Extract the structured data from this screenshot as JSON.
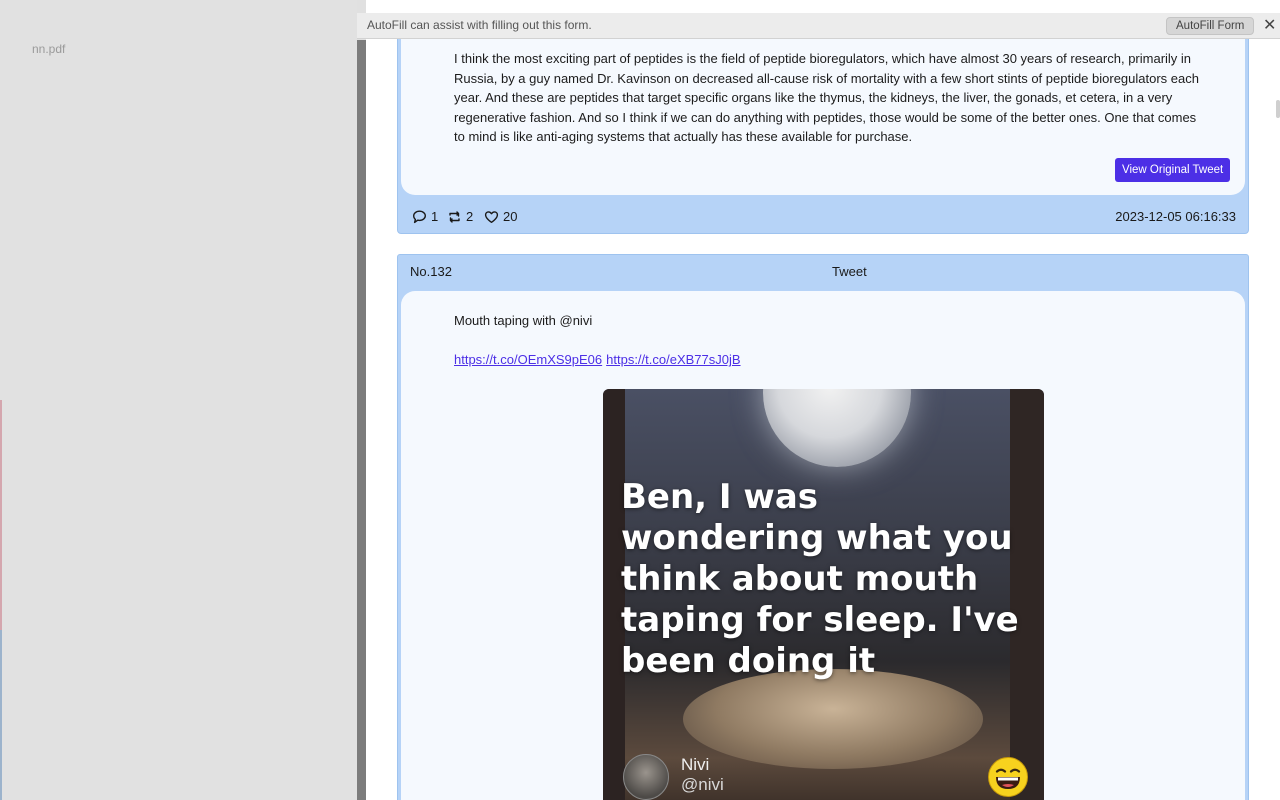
{
  "sidebar": {
    "file_name": "nn.pdf"
  },
  "autofill": {
    "message": "AutoFill can assist with filling out this form.",
    "button_label": "AutoFill Form",
    "close_glyph": "✕"
  },
  "tweet1": {
    "text": "I think the most exciting part of peptides is the field of peptide bioregulators, which have almost 30 years of research, primarily in Russia, by a guy named Dr. Kavinson on decreased all-cause risk of mortality with a few short stints of peptide bioregulators each year. And these are peptides that target specific organs like the thymus, the kidneys, the liver, the gonads, et cetera, in a very regenerative fashion. And so I think if we can do anything with peptides, those would be some of the better ones. One that comes to mind is like anti-aging systems that actually has these available for purchase.",
    "view_button": "View Original Tweet",
    "replies": "1",
    "retweets": "2",
    "likes": "20",
    "timestamp": "2023-12-05 06:16:33",
    "icons": {
      "reply": "speech-bubble-icon",
      "retweet": "retweet-icon",
      "like": "heart-icon"
    }
  },
  "tweet2": {
    "number": "No.132",
    "type_label": "Tweet",
    "text": "Mouth taping with @nivi",
    "links": [
      "https://t.co/OEmXS9pE06",
      "https://t.co/eXB77sJ0jB"
    ],
    "media": {
      "caption": "Ben, I was wondering what you think about mouth taping for sleep. I've been doing it",
      "name": "Nivi",
      "handle": "@nivi",
      "emoji_icon": "laughing-face-icon"
    }
  },
  "colors": {
    "accent": "#4c2fe6",
    "card_frame": "#b6d3f7",
    "card_body": "#f5f9fe",
    "sidebar": "#e1e1e1"
  }
}
